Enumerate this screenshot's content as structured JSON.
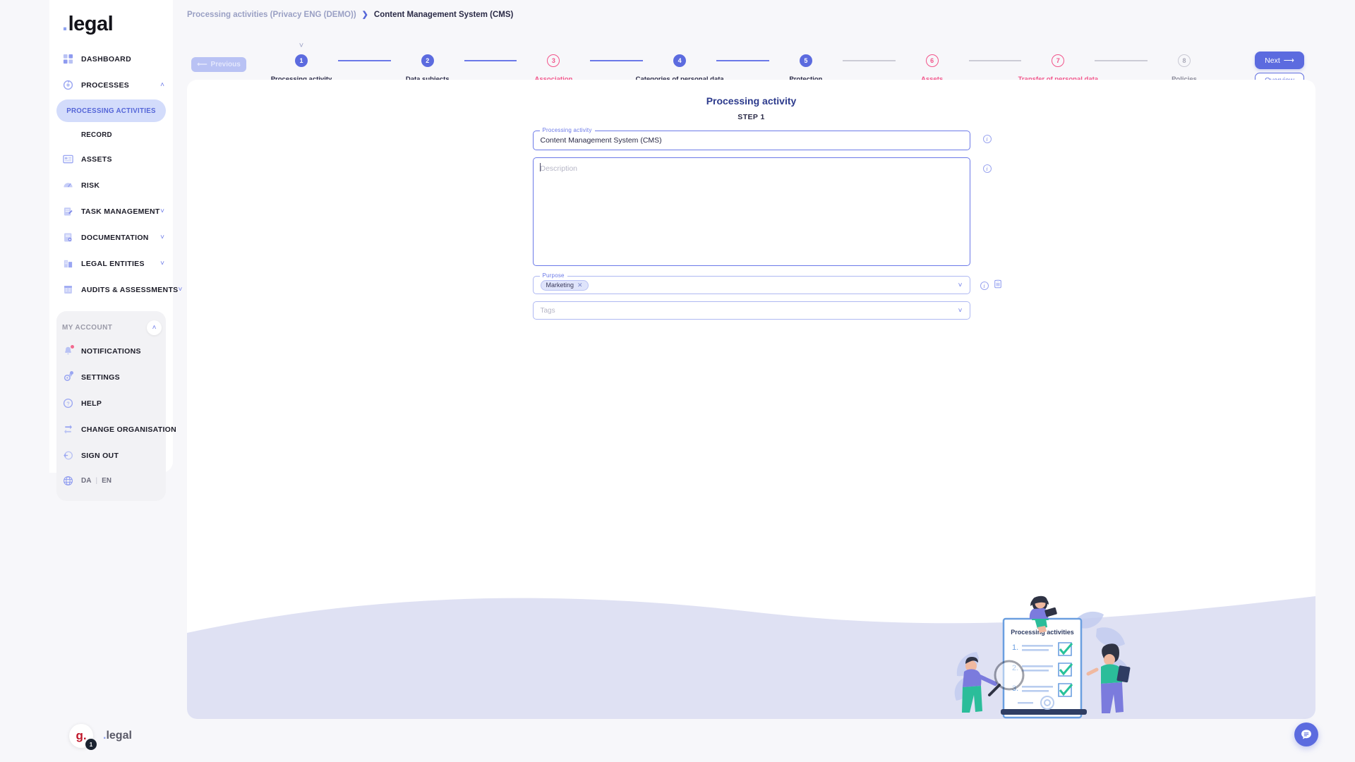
{
  "brand": {
    "logo": "legal",
    "logo_dot": "."
  },
  "sidebar": {
    "items": [
      {
        "label": "DASHBOARD",
        "icon": "dashboard-icon",
        "chevron": ""
      },
      {
        "label": "PROCESSES",
        "icon": "processes-icon",
        "chevron": "˄"
      },
      {
        "label": "ASSETS",
        "icon": "assets-icon",
        "chevron": ""
      },
      {
        "label": "RISK",
        "icon": "risk-icon",
        "chevron": ""
      },
      {
        "label": "TASK MANAGEMENT",
        "icon": "task-icon",
        "chevron": "˅"
      },
      {
        "label": "DOCUMENTATION",
        "icon": "documentation-icon",
        "chevron": "˅"
      },
      {
        "label": "LEGAL ENTITIES",
        "icon": "legal-entities-icon",
        "chevron": "˅"
      },
      {
        "label": "AUDITS & ASSESSMENTS",
        "icon": "audits-icon",
        "chevron": "˅"
      }
    ],
    "sub_active": "PROCESSING ACTIVITIES",
    "sub_item": "RECORD",
    "account": {
      "title": "MY ACCOUNT",
      "collapse": "˄",
      "items": [
        {
          "label": "NOTIFICATIONS",
          "icon": "bell-icon"
        },
        {
          "label": "SETTINGS",
          "icon": "gear-icon"
        },
        {
          "label": "HELP",
          "icon": "help-icon"
        },
        {
          "label": "CHANGE ORGANISATION",
          "icon": "swap-icon"
        },
        {
          "label": "SIGN OUT",
          "icon": "signout-icon"
        }
      ],
      "lang_da": "DA",
      "lang_sep": "|",
      "lang_en": "EN"
    }
  },
  "breadcrumb": {
    "parent": "Processing activities (Privacy ENG (DEMO))",
    "separator": "❯",
    "current": "Content Management System (CMS)"
  },
  "toolbar": {
    "previous_label": "Previous",
    "previous_arrow": "⟵",
    "next_label": "Next",
    "next_arrow": "⟶",
    "overview_label": "Overview",
    "step_chevron": "˅"
  },
  "stepper": {
    "steps": [
      {
        "num": "1",
        "label": "Processing activity",
        "state": "done",
        "current": true
      },
      {
        "num": "2",
        "label": "Data subjects",
        "state": "done",
        "current": false
      },
      {
        "num": "3",
        "label": "Association",
        "state": "warn",
        "current": false
      },
      {
        "num": "4",
        "label": "Categories of personal data",
        "state": "done",
        "current": false
      },
      {
        "num": "5",
        "label": "Protection",
        "state": "done",
        "current": false
      },
      {
        "num": "6",
        "label": "Assets",
        "state": "warn",
        "current": false
      },
      {
        "num": "7",
        "label": "Transfer of personal data",
        "state": "warn",
        "current": false
      },
      {
        "num": "8",
        "label": "Policies",
        "state": "todo",
        "current": false
      }
    ],
    "connectors": [
      "blue",
      "blue",
      "blue",
      "blue",
      "gray",
      "gray",
      "gray"
    ]
  },
  "form": {
    "title": "Processing activity",
    "step_text": "STEP 1",
    "activity_legend": "Processing activity",
    "activity_value": "Content Management System (CMS)",
    "description_placeholder": "Description",
    "purpose_legend": "Purpose",
    "purpose_chip": "Marketing",
    "chip_remove": "✕",
    "tags_placeholder": "Tags",
    "dropdown_chevron": "˅",
    "info_icon": "i"
  },
  "illustration": {
    "checklist_title": "Processing activities",
    "items": [
      "1.",
      "2.",
      "3."
    ]
  },
  "footer": {
    "avatar_text": "g.",
    "badge_count": "1",
    "brand_dot": ".",
    "brand_name": "legal"
  },
  "colors": {
    "accent": "#5c6bdf",
    "warn": "#f2548a",
    "muted": "#8a8a99",
    "band": "#dfe1f3"
  }
}
